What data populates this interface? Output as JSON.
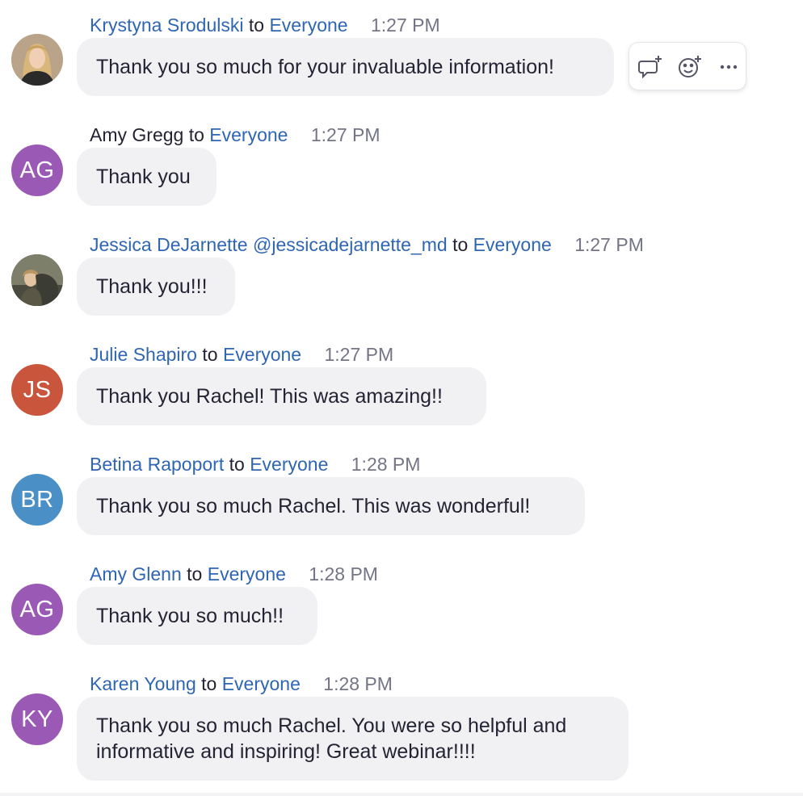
{
  "colors": {
    "link": "#2f66b3",
    "text": "#232333",
    "time": "#747487",
    "bubble": "#f1f1f4",
    "avatar_purple": "#9b59b6",
    "avatar_red": "#c9553c",
    "avatar_blue": "#4a90c6"
  },
  "hover_actions": {
    "reply_icon": "reply-in-thread-icon",
    "reaction_icon": "add-reaction-icon",
    "more_icon": "more-options-icon"
  },
  "messages": [
    {
      "sender": "Krystyna Srodulski",
      "to_word": "to",
      "recipient": "Everyone",
      "time": "1:27 PM",
      "text": "Thank you so much for your invaluable information!",
      "avatar": {
        "type": "photo",
        "icon": "profile-photo"
      }
    },
    {
      "sender": "Amy Gregg",
      "to_word": "to",
      "recipient": "Everyone",
      "time": "1:27 PM",
      "text": "Thank you",
      "avatar": {
        "type": "initials",
        "initials": "AG",
        "color": "#9b59b6"
      }
    },
    {
      "sender": "Jessica DeJarnette @jessicadejarnette_md",
      "to_word": "to",
      "recipient": "Everyone",
      "time": "1:27 PM",
      "text": "Thank you!!!",
      "avatar": {
        "type": "photo",
        "icon": "profile-photo"
      }
    },
    {
      "sender": "Julie Shapiro",
      "to_word": "to",
      "recipient": "Everyone",
      "time": "1:27 PM",
      "text": "Thank you Rachel! This was amazing!!",
      "avatar": {
        "type": "initials",
        "initials": "JS",
        "color": "#c9553c"
      }
    },
    {
      "sender": "Betina Rapoport",
      "to_word": "to",
      "recipient": "Everyone",
      "time": "1:28 PM",
      "text": "Thank you so much Rachel. This was wonderful!",
      "avatar": {
        "type": "initials",
        "initials": "BR",
        "color": "#4a90c6"
      }
    },
    {
      "sender": "Amy Glenn",
      "to_word": "to",
      "recipient": "Everyone",
      "time": "1:28 PM",
      "text": "Thank you so much!!",
      "avatar": {
        "type": "initials",
        "initials": "AG",
        "color": "#9b59b6"
      }
    },
    {
      "sender": "Karen Young",
      "to_word": "to",
      "recipient": "Everyone",
      "time": "1:28 PM",
      "text": "Thank you so much Rachel. You were so helpful and\ninformative and inspiring! Great webinar!!!!",
      "avatar": {
        "type": "initials",
        "initials": "KY",
        "color": "#9b59b6"
      }
    }
  ]
}
